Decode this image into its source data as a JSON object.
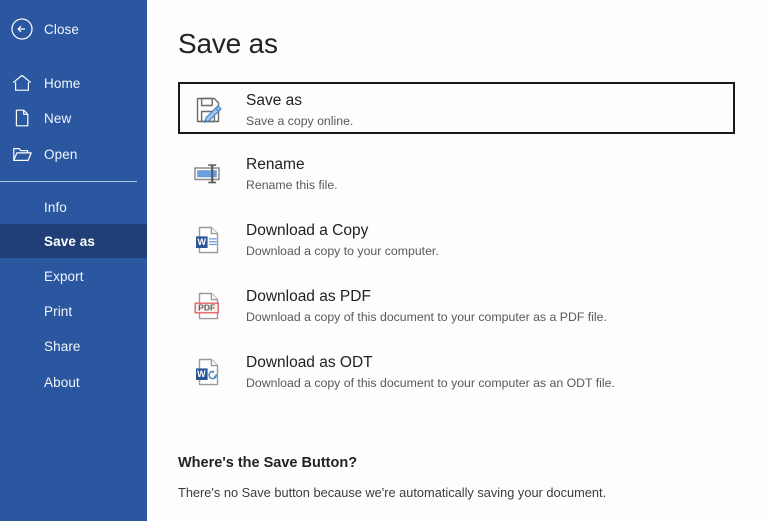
{
  "sidebar": {
    "background_color": "#2a57a0",
    "selected_color": "#1f3f76",
    "top_items": [
      {
        "label": "Close",
        "icon": "back-circle-arrow-icon"
      },
      {
        "label": "Home",
        "icon": "home-icon"
      },
      {
        "label": "New",
        "icon": "new-document-icon"
      },
      {
        "label": "Open",
        "icon": "open-folder-icon"
      }
    ],
    "list_items": [
      {
        "label": "Info",
        "selected": false
      },
      {
        "label": "Save as",
        "selected": true
      },
      {
        "label": "Export",
        "selected": false
      },
      {
        "label": "Print",
        "selected": false
      },
      {
        "label": "Share",
        "selected": false
      },
      {
        "label": "About",
        "selected": false
      }
    ]
  },
  "main": {
    "title": "Save as",
    "options": [
      {
        "title": "Save as",
        "subtitle": "Save a copy online.",
        "icon": "floppy-disk-pencil-icon",
        "focused": true
      },
      {
        "title": "Rename",
        "subtitle": "Rename this file.",
        "icon": "rename-textbox-icon",
        "focused": false
      },
      {
        "title": "Download a Copy",
        "subtitle": "Download a copy to your computer.",
        "icon": "word-document-icon",
        "focused": false
      },
      {
        "title": "Download as PDF",
        "subtitle": "Download a copy of this document to your computer as a PDF file.",
        "icon": "pdf-document-icon",
        "focused": false
      },
      {
        "title": "Download as ODT",
        "subtitle": "Download a copy of this document to your computer as an ODT file.",
        "icon": "odt-document-icon",
        "focused": false
      }
    ],
    "footer": {
      "heading": "Where's the Save Button?",
      "body": "There's no Save button because we're automatically saving your document."
    }
  },
  "colors": {
    "brand_blue": "#2a57a0",
    "selected_blue": "#1f3f76",
    "icon_blue": "#2b579a",
    "pdf_red": "#d96d6d",
    "text_dark": "#232323",
    "text_muted": "#59595c"
  }
}
